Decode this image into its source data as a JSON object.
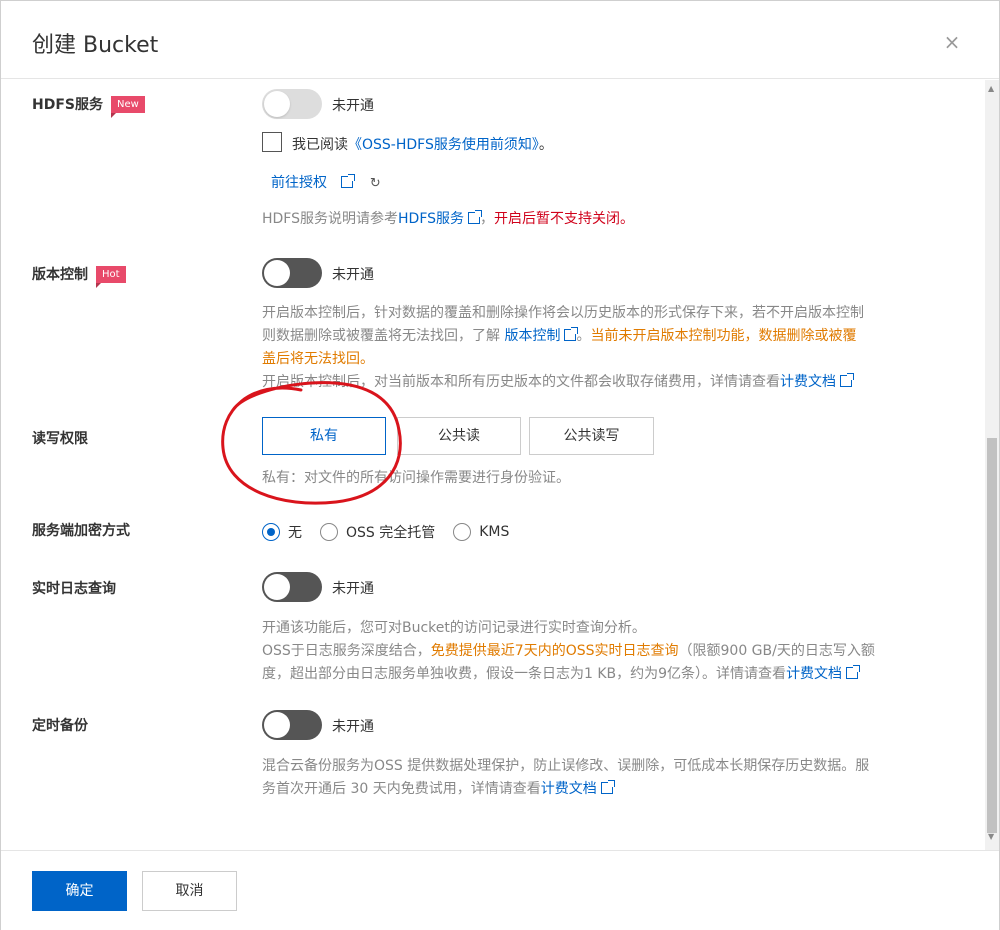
{
  "dialog": {
    "title": "创建 Bucket",
    "close": "×"
  },
  "hdfs": {
    "label": "HDFS服务",
    "badge": "New",
    "toggle_text": "未开通",
    "checkbox_prefix": "我已阅读",
    "notice_link": "《OSS-HDFS服务使用前须知》",
    "notice_suffix": "。",
    "authorize_link": "前往授权",
    "desc_prefix": "HDFS服务说明请参考",
    "desc_link": "HDFS服务",
    "desc_sep": "，",
    "desc_warn": "开启后暂不支持关闭。"
  },
  "versioning": {
    "label": "版本控制",
    "badge": "Hot",
    "toggle_text": "未开通",
    "desc_line1": "开启版本控制后，针对数据的覆盖和删除操作将会以历史版本的形式保存下来，若不开启版本控制",
    "desc_line2_prefix": "则数据删除或被覆盖将无法找回，了解 ",
    "desc_line2_link": "版本控制",
    "desc_line2_sep": "。",
    "desc_line2_warn": "当前未开启版本控制功能，数据删除或被覆",
    "desc_line3_warn": "盖后将无法找回。",
    "desc_line4_prefix": "开启版本控制后，对当前版本和所有历史版本的文件都会收取存储费用，详情请查看",
    "desc_line4_link": "计费文档"
  },
  "acl": {
    "label": "读写权限",
    "options": [
      "私有",
      "公共读",
      "公共读写"
    ],
    "selected": "私有",
    "desc": "私有：对文件的所有访问操作需要进行身份验证。"
  },
  "encryption": {
    "label": "服务端加密方式",
    "options": [
      "无",
      "OSS 完全托管",
      "KMS"
    ],
    "selected": "无"
  },
  "realtime_log": {
    "label": "实时日志查询",
    "toggle_text": "未开通",
    "desc_line1": "开通该功能后，您可对Bucket的访问记录进行实时查询分析。",
    "desc_line2_prefix": "OSS于日志服务深度结合，",
    "desc_line2_warn": "免费提供最近7天内的OSS实时日志查询",
    "desc_line2_suffix": "（限额900 GB/天的日志写入额",
    "desc_line3_prefix": "度，超出部分由日志服务单独收费，假设一条日志为1 KB，约为9亿条）。详情请查看",
    "desc_line3_link": "计费文档"
  },
  "backup": {
    "label": "定时备份",
    "toggle_text": "未开通",
    "desc_line1": "混合云备份服务为OSS 提供数据处理保护，防止误修改、误删除，可低成本长期保存历史数据。服",
    "desc_line2_prefix": "务首次开通后 30 天内免费试用，详情请查看",
    "desc_line2_link": "计费文档"
  },
  "footer": {
    "confirm": "确定",
    "cancel": "取消"
  },
  "colors": {
    "primary": "#0064c8",
    "warn_red": "#d0021b",
    "warn_orange": "#e07b00",
    "badge": "#e84a6a",
    "annotation": "#d9141c"
  }
}
